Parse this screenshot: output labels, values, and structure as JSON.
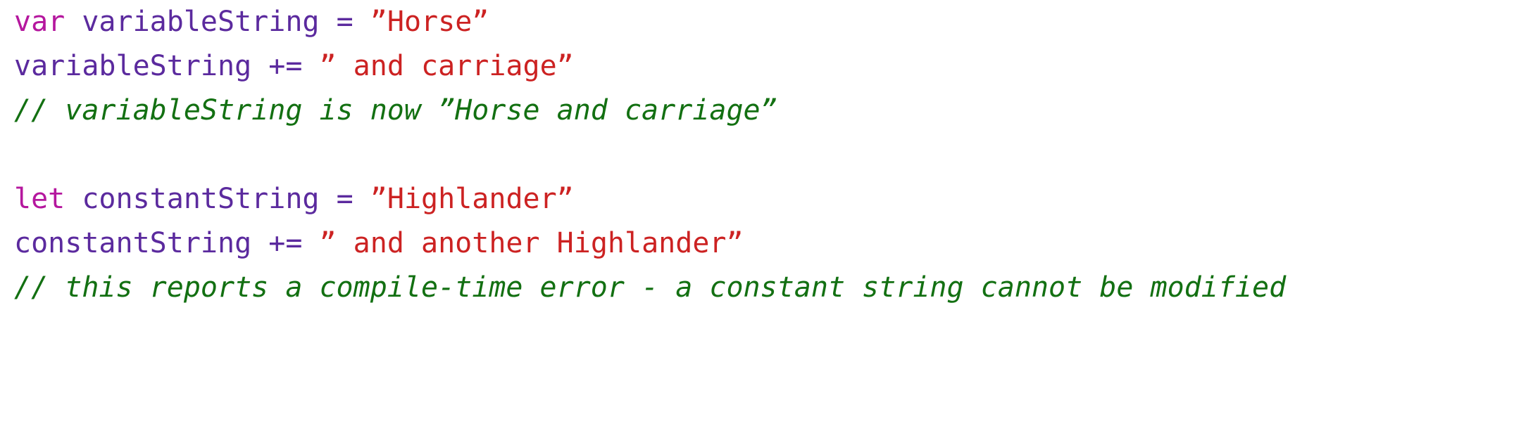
{
  "document": {
    "kind": "code-listing",
    "language": "Swift",
    "background_color": "#ffffff",
    "font_size_px": 40,
    "line_height_px": 63
  },
  "colors": {
    "keyword": "#b5179e",
    "identifier": "#5b2a9e",
    "operator": "#5b2a9e",
    "string": "#cc2222",
    "comment": "#137012",
    "background": "#ffffff"
  },
  "code": {
    "lines": [
      {
        "index": 1,
        "blank": false,
        "text": "var variableString = ”Horse”",
        "tokens": [
          {
            "t": "var",
            "c": "keyword"
          },
          {
            "t": " ",
            "c": "plain"
          },
          {
            "t": "variableString",
            "c": "plain"
          },
          {
            "t": " ",
            "c": "plain"
          },
          {
            "t": "=",
            "c": "operator"
          },
          {
            "t": " ",
            "c": "plain"
          },
          {
            "t": "”Horse”",
            "c": "string"
          }
        ]
      },
      {
        "index": 2,
        "blank": false,
        "text": "variableString += ” and carriage”",
        "tokens": [
          {
            "t": "variableString",
            "c": "plain"
          },
          {
            "t": " ",
            "c": "plain"
          },
          {
            "t": "+=",
            "c": "operator"
          },
          {
            "t": " ",
            "c": "plain"
          },
          {
            "t": "” and carriage”",
            "c": "string"
          }
        ]
      },
      {
        "index": 3,
        "blank": false,
        "text": "// variableString is now ”Horse and carriage”",
        "tokens": [
          {
            "t": "// variableString is now ”Horse and carriage”",
            "c": "comment"
          }
        ]
      },
      {
        "index": 4,
        "blank": true,
        "text": "",
        "tokens": []
      },
      {
        "index": 5,
        "blank": false,
        "text": "let constantString = ”Highlander”",
        "tokens": [
          {
            "t": "let",
            "c": "keyword"
          },
          {
            "t": " ",
            "c": "plain"
          },
          {
            "t": "constantString",
            "c": "plain"
          },
          {
            "t": " ",
            "c": "plain"
          },
          {
            "t": "=",
            "c": "operator"
          },
          {
            "t": " ",
            "c": "plain"
          },
          {
            "t": "”Highlander”",
            "c": "string"
          }
        ]
      },
      {
        "index": 6,
        "blank": false,
        "text": "constantString += ” and another Highlander”",
        "tokens": [
          {
            "t": "constantString",
            "c": "plain"
          },
          {
            "t": " ",
            "c": "plain"
          },
          {
            "t": "+=",
            "c": "operator"
          },
          {
            "t": " ",
            "c": "plain"
          },
          {
            "t": "” and another Highlander”",
            "c": "string"
          }
        ]
      },
      {
        "index": 7,
        "blank": false,
        "text": "// this reports a compile-time error - a constant string cannot be modified",
        "tokens": [
          {
            "t": "// this reports a compile-time error - a constant string cannot be modified",
            "c": "comment"
          }
        ]
      }
    ]
  }
}
